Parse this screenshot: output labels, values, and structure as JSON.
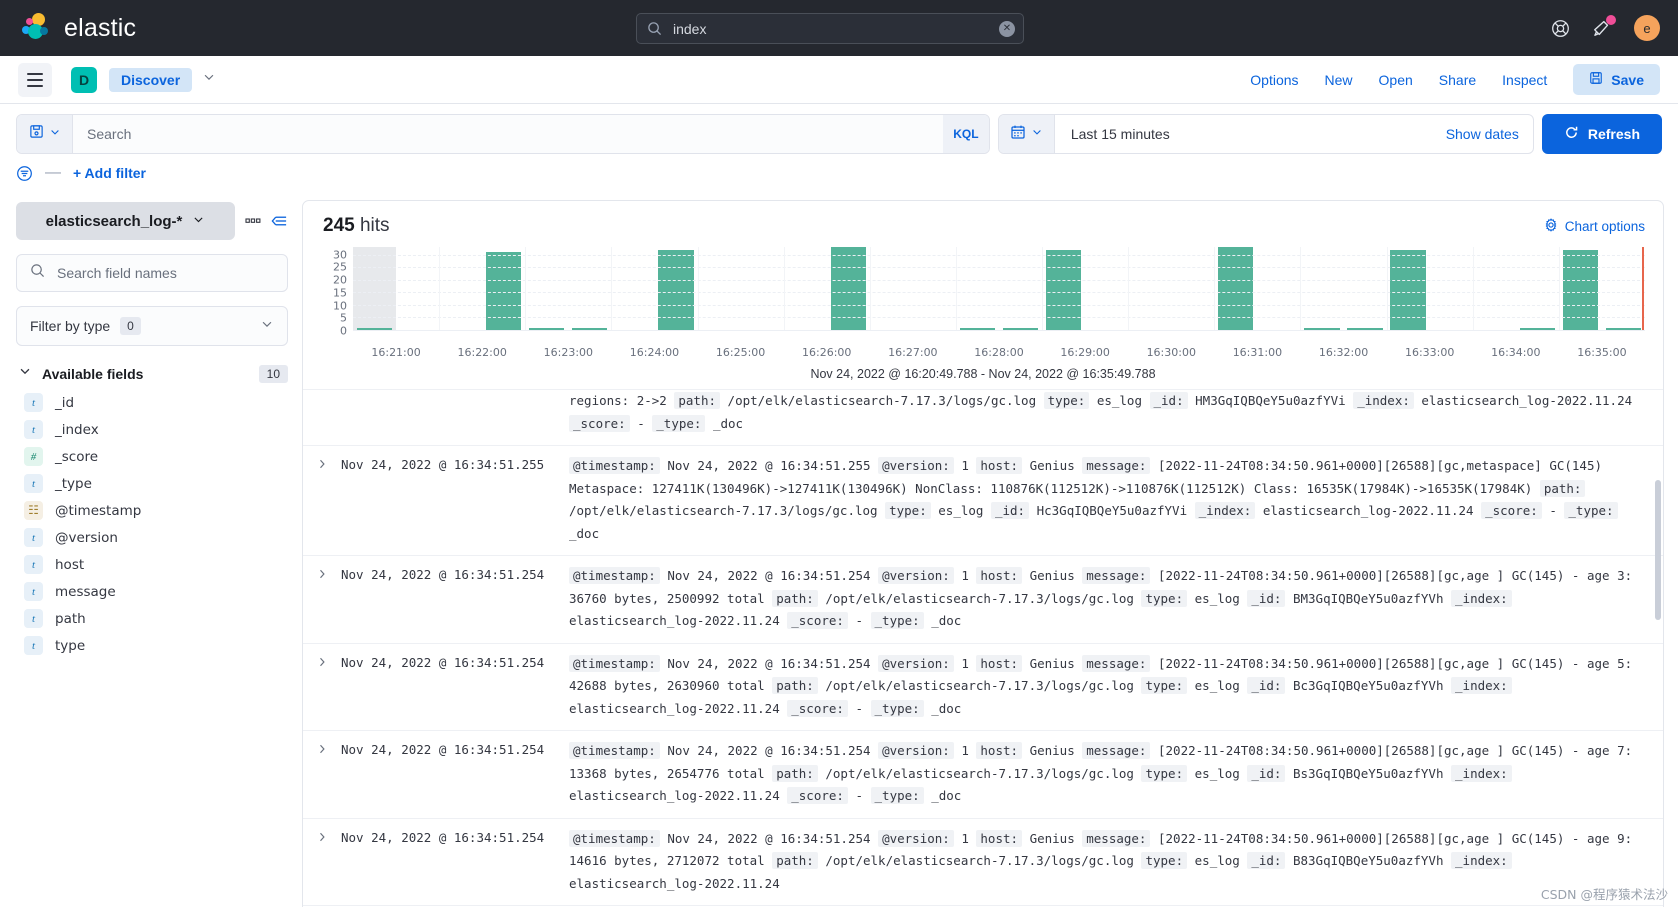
{
  "header": {
    "brand": "elastic",
    "global_search": {
      "value": "index",
      "icon": "search-icon",
      "clear_icon": "clear-icon"
    },
    "help_icon": "lifebuoy-help-icon",
    "announcements_icon": "megaphone-announcements-icon",
    "avatar_initial": "e",
    "brand_colors": {
      "yellow": "#f9bc31",
      "pink": "#ee5097",
      "blue": "#1ba9f5",
      "teal": "#00bfb3",
      "navy": "#0678a0"
    }
  },
  "subnav": {
    "menu_icon": "hamburger-menu-icon",
    "app_badge": "D",
    "breadcrumb": "Discover",
    "chevron_icon": "chevron-down-icon",
    "links": [
      {
        "label": "Options"
      },
      {
        "label": "New"
      },
      {
        "label": "Open"
      },
      {
        "label": "Share"
      },
      {
        "label": "Inspect"
      }
    ],
    "save_label": "Save",
    "save_icon": "save-floppy-icon"
  },
  "querybar": {
    "saved_query_icon": "saved-query-floppy-icon",
    "search_placeholder": "Search",
    "search_value": "",
    "language": "KQL",
    "calendar_icon": "calendar-icon",
    "time_range": "Last 15 minutes",
    "show_dates": "Show dates",
    "refresh_label": "Refresh",
    "refresh_icon": "refresh-icon",
    "accent": "#0b64dd"
  },
  "filterbar": {
    "filter_icon": "filter-list-icon",
    "dash": "—",
    "add_filter": "+ Add filter"
  },
  "sidebar": {
    "index_pattern": "elasticsearch_log-*",
    "index_chevron_icon": "chevron-down-icon",
    "more_icon": "more-options-icon",
    "collapse_icon": "collapse-sidebar-icon",
    "field_search_placeholder": "Search field names",
    "field_search_icon": "search-icon",
    "filter_by_type_label": "Filter by type",
    "filter_by_type_count": "0",
    "available_fields_label": "Available fields",
    "available_fields_count": "10",
    "fields": [
      {
        "name": "_id",
        "type": "string",
        "glyph": "t"
      },
      {
        "name": "_index",
        "type": "string",
        "glyph": "t"
      },
      {
        "name": "_score",
        "type": "number",
        "glyph": "#"
      },
      {
        "name": "_type",
        "type": "string",
        "glyph": "t"
      },
      {
        "name": "@timestamp",
        "type": "date",
        "glyph": "☷"
      },
      {
        "name": "@version",
        "type": "string",
        "glyph": "t"
      },
      {
        "name": "host",
        "type": "string",
        "glyph": "t"
      },
      {
        "name": "message",
        "type": "string",
        "glyph": "t"
      },
      {
        "name": "path",
        "type": "string",
        "glyph": "t"
      },
      {
        "name": "type",
        "type": "string",
        "glyph": "t"
      }
    ]
  },
  "panel": {
    "hits_count": "245",
    "hits_label": "hits",
    "chart_options_label": "Chart options",
    "chart_options_icon": "gear-icon"
  },
  "chart_data": {
    "type": "bar",
    "title": "245 hits",
    "subtitle": "Nov 24, 2022 @ 16:20:49.788 - Nov 24, 2022 @ 16:35:49.788",
    "xlabel": "",
    "ylabel": "",
    "ylim": [
      0,
      33
    ],
    "yticks": [
      0,
      5,
      10,
      15,
      20,
      25,
      30
    ],
    "grid": true,
    "legend": "none",
    "bar_color": "#54b399",
    "partial_bucket_color": "#e3e5e9",
    "now_line_color": "#e7664c",
    "xticks": [
      "16:21:00",
      "16:22:00",
      "16:23:00",
      "16:24:00",
      "16:25:00",
      "16:26:00",
      "16:27:00",
      "16:28:00",
      "16:29:00",
      "16:30:00",
      "16:31:00",
      "16:32:00",
      "16:33:00",
      "16:34:00",
      "16:35:00"
    ],
    "categories": [
      "16:20:30",
      "16:21:00",
      "16:21:30",
      "16:22:00",
      "16:22:30",
      "16:23:00",
      "16:23:30",
      "16:24:00",
      "16:24:30",
      "16:25:00",
      "16:25:30",
      "16:26:00",
      "16:26:30",
      "16:27:00",
      "16:27:30",
      "16:28:00",
      "16:28:30",
      "16:29:00",
      "16:29:30",
      "16:30:00",
      "16:30:30",
      "16:31:00",
      "16:31:30",
      "16:32:00",
      "16:32:30",
      "16:33:00",
      "16:33:30",
      "16:34:00",
      "16:34:30",
      "16:35:00"
    ],
    "values": [
      1,
      0,
      0,
      31,
      1,
      1,
      0,
      32,
      0,
      0,
      0,
      33,
      0,
      0,
      1,
      1,
      32,
      0,
      0,
      0,
      33,
      0,
      1,
      1,
      32,
      0,
      0,
      1,
      32,
      1
    ]
  },
  "documents": [
    {
      "clipped": true,
      "time": "",
      "fields": [
        {
          "k": "",
          "v": "regions: 2->2"
        },
        {
          "k": "path:",
          "v": "/opt/elk/elasticsearch-7.17.3/logs/gc.log"
        },
        {
          "k": "type:",
          "v": "es_log"
        },
        {
          "k": "_id:",
          "v": "HM3GqIQBQeY5u0azfYVi"
        },
        {
          "k": "_index:",
          "v": "elasticsearch_log-2022.11.24"
        },
        {
          "k": "_score:",
          "v": "-"
        },
        {
          "k": "_type:",
          "v": "_doc"
        }
      ]
    },
    {
      "clipped": false,
      "time": "Nov 24, 2022 @ 16:34:51.255",
      "fields": [
        {
          "k": "@timestamp:",
          "v": "Nov 24, 2022 @ 16:34:51.255"
        },
        {
          "k": "@version:",
          "v": "1"
        },
        {
          "k": "host:",
          "v": "Genius"
        },
        {
          "k": "message:",
          "v": "[2022-11-24T08:34:50.961+0000][26588][gc,metaspace] GC(145) Metaspace: 127411K(130496K)->127411K(130496K) NonClass: 110876K(112512K)->110876K(112512K) Class: 16535K(17984K)->16535K(17984K)"
        },
        {
          "k": "path:",
          "v": "/opt/elk/elasticsearch-7.17.3/logs/gc.log"
        },
        {
          "k": "type:",
          "v": "es_log"
        },
        {
          "k": "_id:",
          "v": "Hc3GqIQBQeY5u0azfYVi"
        },
        {
          "k": "_index:",
          "v": "elasticsearch_log-2022.11.24"
        },
        {
          "k": "_score:",
          "v": "-"
        },
        {
          "k": "_type:",
          "v": "_doc"
        }
      ]
    },
    {
      "clipped": false,
      "time": "Nov 24, 2022 @ 16:34:51.254",
      "fields": [
        {
          "k": "@timestamp:",
          "v": "Nov 24, 2022 @ 16:34:51.254"
        },
        {
          "k": "@version:",
          "v": "1"
        },
        {
          "k": "host:",
          "v": "Genius"
        },
        {
          "k": "message:",
          "v": "[2022-11-24T08:34:50.961+0000][26588][gc,age ] GC(145) - age 3: 36760 bytes, 2500992 total"
        },
        {
          "k": "path:",
          "v": "/opt/elk/elasticsearch-7.17.3/logs/gc.log"
        },
        {
          "k": "type:",
          "v": "es_log"
        },
        {
          "k": "_id:",
          "v": "BM3GqIQBQeY5u0azfYVh"
        },
        {
          "k": "_index:",
          "v": "elasticsearch_log-2022.11.24"
        },
        {
          "k": "_score:",
          "v": "-"
        },
        {
          "k": "_type:",
          "v": "_doc"
        }
      ]
    },
    {
      "clipped": false,
      "time": "Nov 24, 2022 @ 16:34:51.254",
      "fields": [
        {
          "k": "@timestamp:",
          "v": "Nov 24, 2022 @ 16:34:51.254"
        },
        {
          "k": "@version:",
          "v": "1"
        },
        {
          "k": "host:",
          "v": "Genius"
        },
        {
          "k": "message:",
          "v": "[2022-11-24T08:34:50.961+0000][26588][gc,age ] GC(145) - age 5: 42688 bytes, 2630960 total"
        },
        {
          "k": "path:",
          "v": "/opt/elk/elasticsearch-7.17.3/logs/gc.log"
        },
        {
          "k": "type:",
          "v": "es_log"
        },
        {
          "k": "_id:",
          "v": "Bc3GqIQBQeY5u0azfYVh"
        },
        {
          "k": "_index:",
          "v": "elasticsearch_log-2022.11.24"
        },
        {
          "k": "_score:",
          "v": "-"
        },
        {
          "k": "_type:",
          "v": "_doc"
        }
      ]
    },
    {
      "clipped": false,
      "time": "Nov 24, 2022 @ 16:34:51.254",
      "fields": [
        {
          "k": "@timestamp:",
          "v": "Nov 24, 2022 @ 16:34:51.254"
        },
        {
          "k": "@version:",
          "v": "1"
        },
        {
          "k": "host:",
          "v": "Genius"
        },
        {
          "k": "message:",
          "v": "[2022-11-24T08:34:50.961+0000][26588][gc,age ] GC(145) - age 7: 13368 bytes, 2654776 total"
        },
        {
          "k": "path:",
          "v": "/opt/elk/elasticsearch-7.17.3/logs/gc.log"
        },
        {
          "k": "type:",
          "v": "es_log"
        },
        {
          "k": "_id:",
          "v": "Bs3GqIQBQeY5u0azfYVh"
        },
        {
          "k": "_index:",
          "v": "elasticsearch_log-2022.11.24"
        },
        {
          "k": "_score:",
          "v": "-"
        },
        {
          "k": "_type:",
          "v": "_doc"
        }
      ]
    },
    {
      "clipped": false,
      "time": "Nov 24, 2022 @ 16:34:51.254",
      "fields": [
        {
          "k": "@timestamp:",
          "v": "Nov 24, 2022 @ 16:34:51.254"
        },
        {
          "k": "@version:",
          "v": "1"
        },
        {
          "k": "host:",
          "v": "Genius"
        },
        {
          "k": "message:",
          "v": "[2022-11-24T08:34:50.961+0000][26588][gc,age ] GC(145) - age 9: 14616 bytes, 2712072 total"
        },
        {
          "k": "path:",
          "v": "/opt/elk/elasticsearch-7.17.3/logs/gc.log"
        },
        {
          "k": "type:",
          "v": "es_log"
        },
        {
          "k": "_id:",
          "v": "B83GqIQBQeY5u0azfYVh"
        },
        {
          "k": "_index:",
          "v": "elasticsearch_log-2022.11.24"
        }
      ]
    }
  ],
  "watermark": "CSDN @程序猿术法沙"
}
